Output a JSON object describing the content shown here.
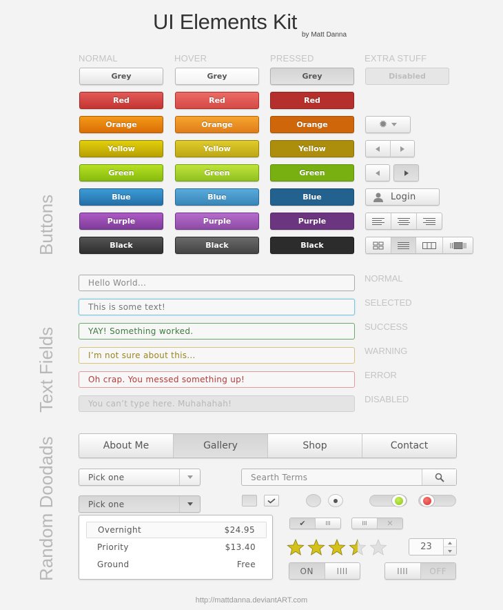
{
  "header": {
    "title": "UI Elements Kit",
    "byline": "by Matt Danna"
  },
  "sections": {
    "buttons": "Buttons",
    "text_fields": "Text Fields",
    "random": "Random Doodads"
  },
  "button_columns": [
    "NORMAL",
    "HOVER",
    "PRESSED",
    "EXTRA STUFF"
  ],
  "button_rows": [
    {
      "label": "Grey",
      "key": "grey"
    },
    {
      "label": "Red",
      "key": "red"
    },
    {
      "label": "Orange",
      "key": "orange"
    },
    {
      "label": "Yellow",
      "key": "yellow"
    },
    {
      "label": "Green",
      "key": "green"
    },
    {
      "label": "Blue",
      "key": "blue"
    },
    {
      "label": "Purple",
      "key": "purple"
    },
    {
      "label": "Black",
      "key": "black"
    }
  ],
  "extra": {
    "disabled_label": "Disabled",
    "login_label": "Login",
    "settings_icon": "gear-icon",
    "pager_pressed": "next"
  },
  "text_fields": [
    {
      "state": "NORMAL",
      "value": "Hello World..."
    },
    {
      "state": "SELECTED",
      "value": "This is some text!"
    },
    {
      "state": "SUCCESS",
      "value": "YAY! Something worked."
    },
    {
      "state": "WARNING",
      "value": "I’m not sure about this..."
    },
    {
      "state": "ERROR",
      "value": "Oh crap. You messed something up!"
    },
    {
      "state": "DISABLED",
      "value": "You can’t type here. Muhahahah!"
    }
  ],
  "nav": {
    "items": [
      "About Me",
      "Gallery",
      "Shop",
      "Contact"
    ],
    "active": "Gallery"
  },
  "select_closed": {
    "value": "Pick one"
  },
  "select_open": {
    "value": "Pick one"
  },
  "dropdown": {
    "options": [
      {
        "label": "Overnight",
        "price": "$24.95",
        "selected": true
      },
      {
        "label": "Priority",
        "price": "$13.40",
        "selected": false
      },
      {
        "label": "Ground",
        "price": "Free",
        "selected": false
      }
    ]
  },
  "search": {
    "placeholder": "Searth Terms"
  },
  "checkboxes": [
    false,
    true
  ],
  "radios": [
    false,
    true
  ],
  "pill_toggles": [
    {
      "state": "on",
      "color": "#8cc21b"
    },
    {
      "state": "off",
      "color": "#d9312d"
    }
  ],
  "mini_toggles": [
    {
      "state": "on",
      "on_symbol": "✔",
      "grip": "III"
    },
    {
      "state": "off",
      "grip": "III",
      "off_symbol": "✕"
    }
  ],
  "rating": {
    "value": 3.5,
    "max": 5
  },
  "stepper": {
    "value": "23"
  },
  "onoff": [
    {
      "state": "on",
      "label": "ON",
      "grip": "IIII"
    },
    {
      "state": "off",
      "label": "OFF",
      "grip": "IIII"
    }
  ],
  "footer": "http://mattdanna.deviantART.com"
}
